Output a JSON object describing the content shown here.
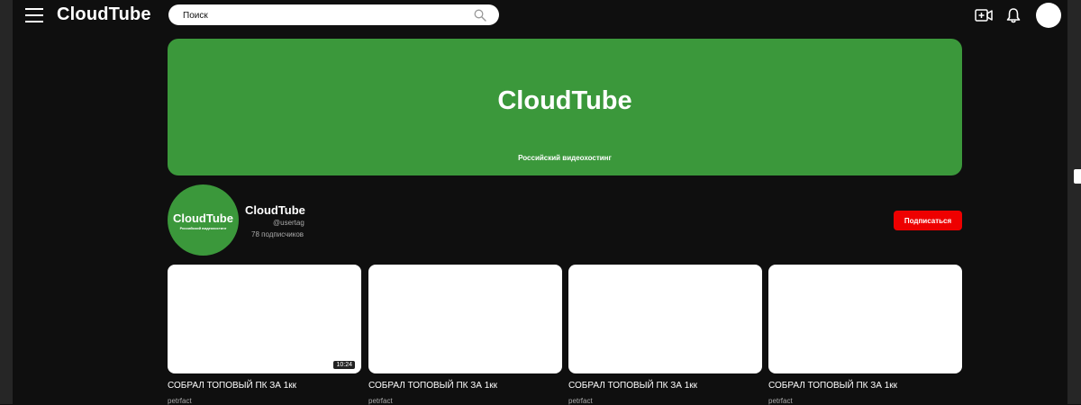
{
  "app": {
    "logo": "CloudTube"
  },
  "search": {
    "placeholder": "Поиск"
  },
  "banner": {
    "title": "CloudTube",
    "subtitle": "Российский видеохостинг"
  },
  "channel": {
    "avatar_title": "CloudTube",
    "avatar_subtitle": "Российский видеохостинг",
    "name": "CloudTube",
    "handle": "@usertag",
    "subscribers": "78 подписчиков",
    "subscribe_label": "Подписаться"
  },
  "videos": [
    {
      "title": "СОБРАЛ ТОПОВЫЙ ПК ЗА 1кк",
      "author": "petrfact",
      "duration": "10:24"
    },
    {
      "title": "СОБРАЛ ТОПОВЫЙ ПК ЗА 1кк",
      "author": "petrfact",
      "duration": ""
    },
    {
      "title": "СОБРАЛ ТОПОВЫЙ ПК ЗА 1кк",
      "author": "petrfact",
      "duration": ""
    },
    {
      "title": "СОБРАЛ ТОПОВЫЙ ПК ЗА 1кк",
      "author": "petrfact",
      "duration": ""
    }
  ],
  "colors": {
    "brand_green": "#3b983b",
    "subscribe_red": "#ee0000",
    "background": "#0f0f0f"
  },
  "icons": [
    "menu-icon",
    "search-icon",
    "create-video-icon",
    "bell-icon"
  ]
}
